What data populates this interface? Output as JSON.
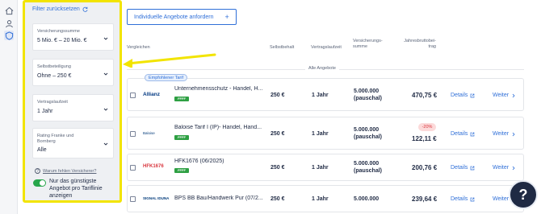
{
  "sidebar": {
    "reset_label": "Filter zurücksetzen",
    "filters": [
      {
        "label": "Versicherungssumme",
        "value": "5 Mio. € – 20 Mio. €"
      },
      {
        "label": "Selbstbeteiligung",
        "value": "Ohne – 250 €"
      },
      {
        "label": "Vertragslaufzeit",
        "value": "1 Jahr"
      },
      {
        "label": "Rating Franke und Bornberg",
        "value": "Alle"
      }
    ],
    "missing_insurer_link": "Warum fehlen Versicherer?",
    "toggle_label": "Nur das günstigste Angebot pro Tariflinie anzeigen",
    "toggle_on": true
  },
  "main": {
    "request_button": "Individuelle Angebote anfordern",
    "request_plus": "+",
    "columns": {
      "compare": "Vergleichen",
      "deductible": "Selbstbehalt",
      "term": "Vertragslaufzeit",
      "sum_insured": "Versicherungs-\nsumme",
      "premium": "Jahresbruttobei-\ntrag"
    },
    "section_label": "Alle Angebote",
    "recommended_label": "Empfohlener Tarif",
    "rows": [
      {
        "insurer": "Allianz",
        "tariff": "Unternehmensschutz - Handel, H...",
        "badge": "FFFF",
        "deductible": "250 €",
        "term": "1 Jahr",
        "sum": "5.000.000",
        "sum_note": "(pauschal)",
        "price": "470,75 €",
        "discount": "",
        "details": "Details",
        "next": "Weiter"
      },
      {
        "insurer": "Baloise",
        "tariff": "Baloise Tarif I (IP)- Handel, Hand...",
        "badge": "FFFF",
        "deductible": "250 €",
        "term": "1 Jahr",
        "sum": "5.000.000",
        "sum_note": "(pauschal)",
        "price": "122,11 €",
        "discount": "-20%",
        "details": "Details",
        "next": "Weiter"
      },
      {
        "insurer": "HFK1676",
        "tariff": "HFK1676 (06/2025)",
        "badge": "FFFF",
        "deductible": "250 €",
        "term": "1 Jahr",
        "sum": "5.000.000",
        "sum_note": "(pauschal)",
        "price": "200,76 €",
        "discount": "",
        "details": "Details",
        "next": "Weiter"
      },
      {
        "insurer": "SIGNAL IDUNA",
        "tariff": "BPS BB Bau/Handwerk Pur (07/2...",
        "badge": "",
        "deductible": "250 €",
        "term": "1 Jahr",
        "sum": "5.000.000",
        "sum_note": "",
        "price": "239,64 €",
        "discount": "",
        "details": "Details",
        "next": "Weiter"
      }
    ]
  },
  "help_label": "?",
  "colors": {
    "accent": "#2f6fd8",
    "highlight": "#f2e400",
    "success": "#2ea043",
    "discount": "#d9363e"
  }
}
